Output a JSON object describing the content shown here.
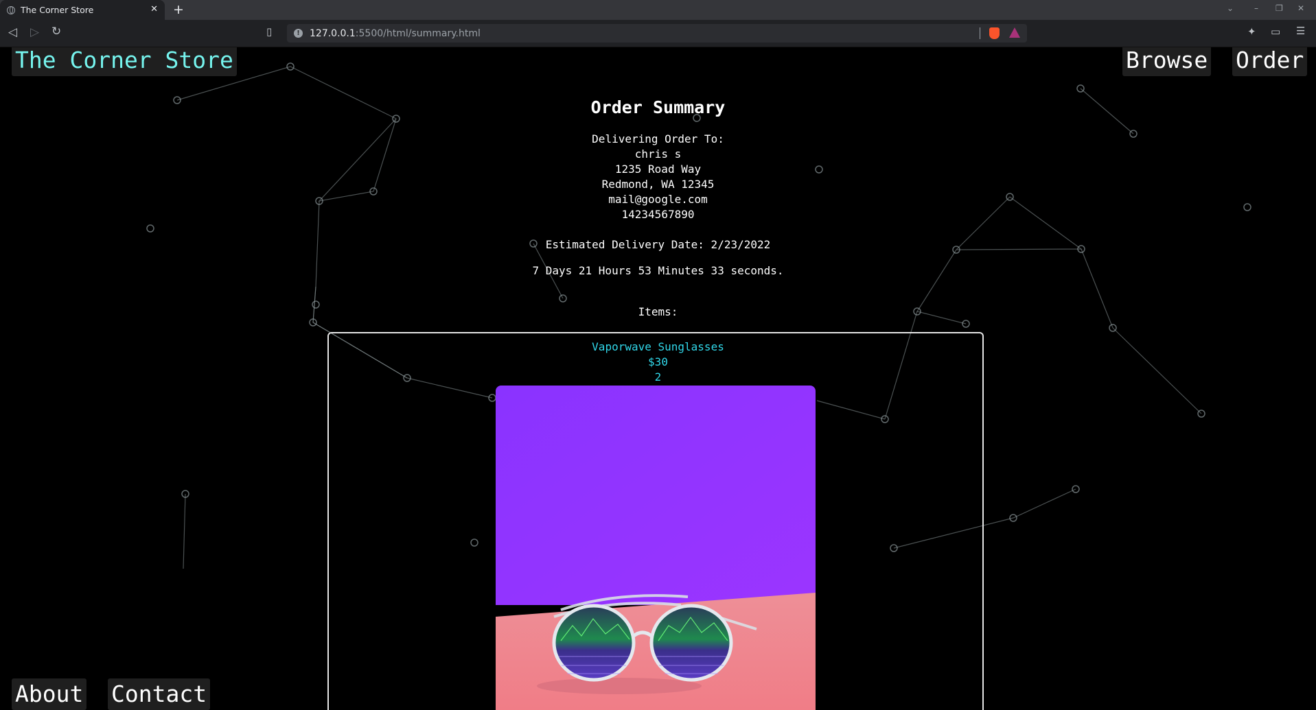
{
  "browser": {
    "tab_title": "The Corner Store",
    "tab_close": "✕",
    "new_tab": "+",
    "url_host": "127.0.0.1",
    "url_path": ":5500/html/summary.html",
    "win_controls": [
      "⌄",
      "–",
      "❐",
      "✕"
    ]
  },
  "nav": {
    "brand": "The Corner Store",
    "browse": "Browse",
    "order": "Order",
    "about": "About",
    "contact": "Contact"
  },
  "summary": {
    "title": "Order Summary",
    "address_lines": [
      "Delivering Order To:",
      "chris s",
      "1235 Road Way",
      "Redmond, WA 12345",
      "mail@google.com",
      "14234567890"
    ],
    "delivery_date": "Estimated Delivery Date: 2/23/2022",
    "countdown": "7 Days 21 Hours 53 Minutes 33 seconds.",
    "items_label": "Items:"
  },
  "items": [
    {
      "name": "Vaporwave Sunglasses",
      "price": "$30",
      "quantity": "2",
      "image_icon": "vaporwave-sunglasses-photo"
    }
  ],
  "colors": {
    "brand_text": "#76f4ee",
    "item_text": "#31d8ea",
    "background": "#000000",
    "button_bg": "#1f1f1f"
  }
}
